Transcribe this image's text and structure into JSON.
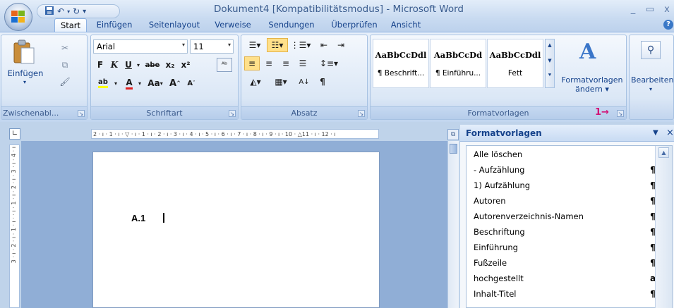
{
  "window": {
    "title": "Dokument4 [Kompatibilitätsmodus] - Microsoft Word",
    "minimize": "_",
    "restore": "▭",
    "close": "x"
  },
  "qat": {
    "save_icon": "save-icon",
    "undo_icon": "undo-icon",
    "redo_icon": "redo-icon"
  },
  "tabs": [
    "Start",
    "Einfügen",
    "Seitenlayout",
    "Verweise",
    "Sendungen",
    "Überprüfen",
    "Ansicht"
  ],
  "help_icon": "help-icon",
  "clipboard": {
    "label": "Zwischenabl...",
    "paste": "Einfügen"
  },
  "font": {
    "label": "Schriftart",
    "family": "Arial",
    "size": "11",
    "bold": "F",
    "italic": "K",
    "underline": "U",
    "strike": "abe",
    "sub": "x₂",
    "sup": "x²",
    "case": "Aa",
    "grow": "A",
    "shrink": "A"
  },
  "paragraph": {
    "label": "Absatz"
  },
  "styles": {
    "label": "Formatvorlagen",
    "items": [
      {
        "sample": "AaBbCcDdl",
        "name": "¶ Beschrift..."
      },
      {
        "sample": "AaBbCcDd",
        "name": "¶ Einführu..."
      },
      {
        "sample": "AaBbCcDdl",
        "name": "Fett"
      }
    ],
    "change_line1": "Formatvorlagen",
    "change_line2": "ändern ▾"
  },
  "editing": {
    "label": "Bearbeiten"
  },
  "annotation": {
    "text": "1",
    "arrow": "→"
  },
  "ruler": {
    "marks": "2 · ı · 1 · ı · ▽ · ı · 1 · ı · 2 · ı · 3 · ı · 4 · ı · 5 · ı · 6 · ı · 7 · ı · 8 · ı · 9 · ı · 10 · △11 · ı · 12 · ı",
    "vmarks": "3 · ı · 2 · ı · 1 · ı · · ı · 1 · ı · 2 · ı · 3 · ı · 4 · ı"
  },
  "document": {
    "text": "A.1"
  },
  "pane": {
    "title": "Formatvorlagen",
    "items": [
      {
        "name": "Alle löschen",
        "mark": ""
      },
      {
        "name": "- Aufzählung",
        "mark": "¶"
      },
      {
        "name": "1) Aufzählung",
        "mark": "¶"
      },
      {
        "name": "Autoren",
        "mark": "¶"
      },
      {
        "name": "Autorenverzeichnis-Namen",
        "mark": "¶"
      },
      {
        "name": "Beschriftung",
        "mark": "¶"
      },
      {
        "name": "Einführung",
        "mark": "¶"
      },
      {
        "name": "Fußzeile",
        "mark": "¶"
      },
      {
        "name": "hochgestellt",
        "mark": "a"
      },
      {
        "name": "Inhalt-Titel",
        "mark": "¶"
      }
    ]
  }
}
